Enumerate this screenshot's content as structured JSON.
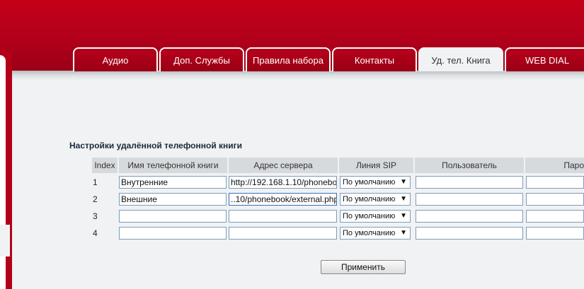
{
  "tabs": [
    {
      "label": "Аудио"
    },
    {
      "label": "Доп. Службы"
    },
    {
      "label": "Правила набора"
    },
    {
      "label": "Контакты"
    },
    {
      "label": "Уд. тел. Книга",
      "active": true
    },
    {
      "label": "WEB DIAL"
    }
  ],
  "section_title": "Настройки удалённой телефонной книги",
  "table": {
    "headers": [
      "Index",
      "Имя телефонной книги",
      "Адрес сервера",
      "Линия SIP",
      "Пользователь",
      "Паро"
    ],
    "rows": [
      {
        "index": "1",
        "name": "Внутренние",
        "server": "http://192.168.1.10/phonebo",
        "sip": "По умолчанию",
        "user": "",
        "password": ""
      },
      {
        "index": "2",
        "name": "Внешние",
        "server": "..10/phonebook/external.php",
        "sip": "По умолчанию",
        "user": "",
        "password": ""
      },
      {
        "index": "3",
        "name": "",
        "server": "",
        "sip": "По умолчанию",
        "user": "",
        "password": ""
      },
      {
        "index": "4",
        "name": "",
        "server": "",
        "sip": "По умолчанию",
        "user": "",
        "password": ""
      }
    ]
  },
  "apply_label": "Применить",
  "colors": {
    "brand_red": "#b2001b",
    "panel_bg": "#f0f2f4",
    "header_cell": "#d7dadd"
  },
  "icons": {
    "select_arrow": "dropdown-arrow-icon"
  }
}
